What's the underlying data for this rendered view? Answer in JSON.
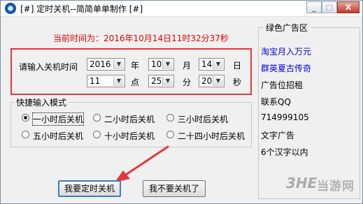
{
  "window": {
    "title": "[#] 定时关机--简简单单制作 [#]",
    "controls": {
      "minimize": "_",
      "maximize": "□",
      "close": "X"
    }
  },
  "current_time_label": "当前时间为：2016年10月14日11时32分37秒",
  "input": {
    "label": "请输入关机时间",
    "year": {
      "value": "2016",
      "unit": "年"
    },
    "month": {
      "value": "10",
      "unit": "月"
    },
    "day": {
      "value": "14",
      "unit": "日"
    },
    "hour": {
      "value": "11",
      "unit": "点"
    },
    "minute": {
      "value": "25",
      "unit": "分"
    },
    "second": {
      "value": "20",
      "unit": "秒"
    }
  },
  "quick_mode": {
    "title": "快捷输入模式",
    "options": [
      {
        "label": "一小时后关机",
        "selected": true
      },
      {
        "label": "二小时后关机",
        "selected": false
      },
      {
        "label": "三小时后关机",
        "selected": false
      },
      {
        "label": "五小时后关机",
        "selected": false
      },
      {
        "label": "十小时后关机",
        "selected": false
      },
      {
        "label": "二十四小时后关机",
        "selected": false
      }
    ]
  },
  "buttons": {
    "shutdown": "我要定时关机",
    "cancel": "我不要关机了"
  },
  "ad_panel": {
    "title": "绿色广告区",
    "items": [
      {
        "text": "淘宝月入万元",
        "link": true
      },
      {
        "text": "群英夏古传奇",
        "link": true
      },
      {
        "text": "广告位招租",
        "link": false
      },
      {
        "text": "联系QQ",
        "link": false
      },
      {
        "text": "714999105",
        "link": false
      },
      {
        "text": "文字广告",
        "link": false
      },
      {
        "text": "6个汉字以内",
        "link": false
      }
    ]
  },
  "watermark": {
    "logo": "3HE",
    "text": "当游网"
  },
  "colors": {
    "current_time": "#e00000",
    "highlight_box": "#e0393a",
    "ad_link": "#0000e0",
    "annotation_arrow": "#e0393a"
  }
}
